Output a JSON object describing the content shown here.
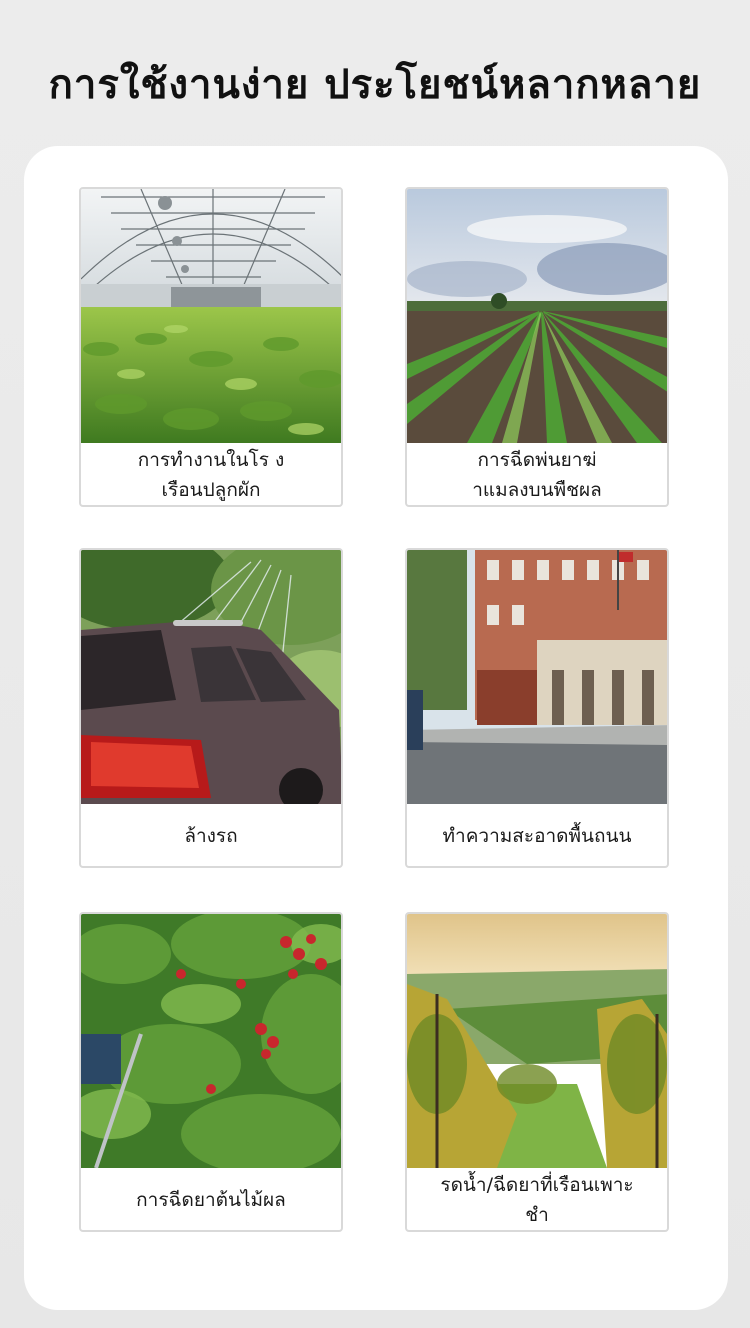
{
  "header": {
    "title": "การใช้งานง่าย ประโยชน์หลากหลาย"
  },
  "cards": [
    {
      "label": "การทำงานในโร ง\nเรือนปลูกผัก",
      "image": "greenhouse-photo"
    },
    {
      "label": "การฉีดพ่นยาฆ่\nาแมลงบนพืชผล",
      "image": "crop-field-photo"
    },
    {
      "label": "ล้างรถ",
      "image": "car-wash-photo"
    },
    {
      "label": "ทำความสะอาดพื้นถนน",
      "image": "street-photo"
    },
    {
      "label": "การฉีดยาต้นไม้ผล",
      "image": "apple-tree-photo"
    },
    {
      "label": "รดน้ำ/ฉีดยาที่เรือนเพาะชำ",
      "image": "vineyard-photo"
    }
  ]
}
